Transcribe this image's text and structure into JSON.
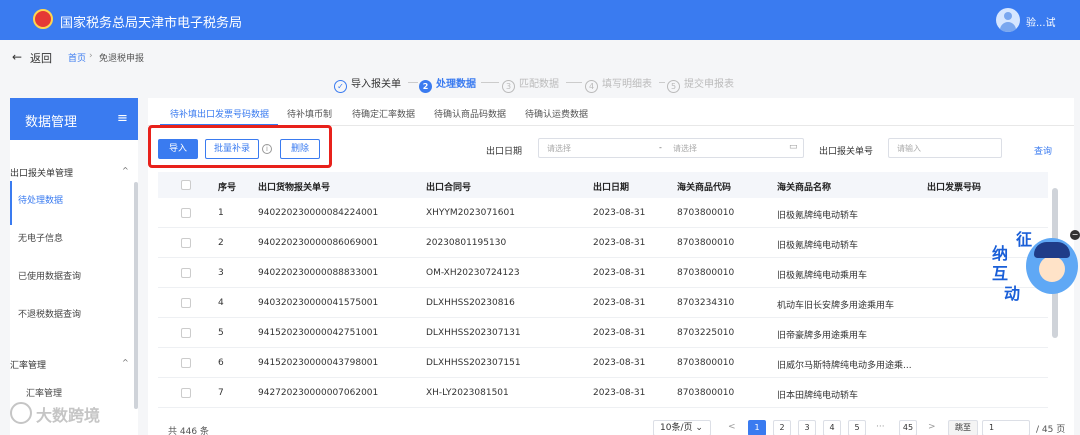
{
  "header": {
    "site_title": "国家税务总局天津市电子税务局",
    "user_name": "验...试"
  },
  "breadcrumb": {
    "back_label": "返回",
    "home": "首页",
    "separator": "›",
    "current": "免退税申报"
  },
  "steps": [
    {
      "num": "✓",
      "label": "导入报关单"
    },
    {
      "num": "2",
      "label": "处理数据"
    },
    {
      "num": "3",
      "label": "匹配数据"
    },
    {
      "num": "4",
      "label": "填写明细表"
    },
    {
      "num": "5",
      "label": "提交申报表"
    }
  ],
  "sidebar": {
    "title": "数据管理",
    "menu_icon": "≡",
    "groups": [
      {
        "label": "出口报关单管理",
        "caret": "^"
      },
      {
        "label": "汇率管理",
        "caret": "^"
      }
    ],
    "items": [
      "待处理数据",
      "无电子信息",
      "已使用数据查询",
      "不退税数据查询",
      "汇率管理"
    ]
  },
  "tabs": [
    "待补填出口发票号码数据",
    "待补填币制",
    "待确定汇率数据",
    "待确认商品码数据",
    "待确认运费数据"
  ],
  "toolbar": {
    "import": "导入",
    "batch_fill": "批量补录",
    "info": "i",
    "delete": "删除"
  },
  "filters": {
    "export_date_label": "出口日期",
    "date_start_placeholder": "请选择",
    "date_sep": "-",
    "date_end_placeholder": "请选择",
    "cal_icon": "▭",
    "declaration_label": "出口报关单号",
    "declaration_placeholder": "请输入",
    "query": "查询"
  },
  "table": {
    "headers": [
      "序号",
      "出口货物报关单号",
      "出口合同号",
      "出口日期",
      "海关商品代码",
      "海关商品名称",
      "出口发票号码"
    ],
    "rows": [
      [
        "1",
        "940220230000084224001",
        "XHYYM2023071601",
        "2023-08-31",
        "8703800010",
        "旧极氪牌纯电动轿车"
      ],
      [
        "2",
        "940220230000086069001",
        "20230801195130",
        "2023-08-31",
        "8703800010",
        "旧极氪牌纯电动轿车"
      ],
      [
        "3",
        "940220230000088833001",
        "OM-XH20230724123",
        "2023-08-31",
        "8703800010",
        "旧极氪牌纯电动乘用车"
      ],
      [
        "4",
        "940320230000041575001",
        "DLXHHSS20230816",
        "2023-08-31",
        "8703234310",
        "机动车旧长安牌多用途乘用车"
      ],
      [
        "5",
        "941520230000042751001",
        "DLXHHSS202307131",
        "2023-08-31",
        "8703225010",
        "旧帝豪牌多用途乘用车"
      ],
      [
        "6",
        "941520230000043798001",
        "DLXHHSS202307151",
        "2023-08-31",
        "8703800010",
        "旧威尔马斯特牌纯电动多用途乘..."
      ],
      [
        "7",
        "942720230000007062001",
        "XH-LY2023081501",
        "2023-08-31",
        "8703800010",
        "旧本田牌纯电动轿车"
      ]
    ]
  },
  "pagination": {
    "total": "共 446 条",
    "page_size": "10条/页 ⌄",
    "prev": "<",
    "pages": [
      "1",
      "2",
      "3",
      "4",
      "5"
    ],
    "ellipsis": "···",
    "last": "45",
    "next": ">",
    "goto_label": "跳至",
    "goto_value": "1",
    "page_total": "/ 45 页"
  },
  "widget": {
    "chars": [
      "征",
      "纳",
      "互",
      "动"
    ]
  },
  "watermark": "大数跨境",
  "colors": {
    "primary": "#3a7bf0",
    "highlight": "#e8211b"
  }
}
